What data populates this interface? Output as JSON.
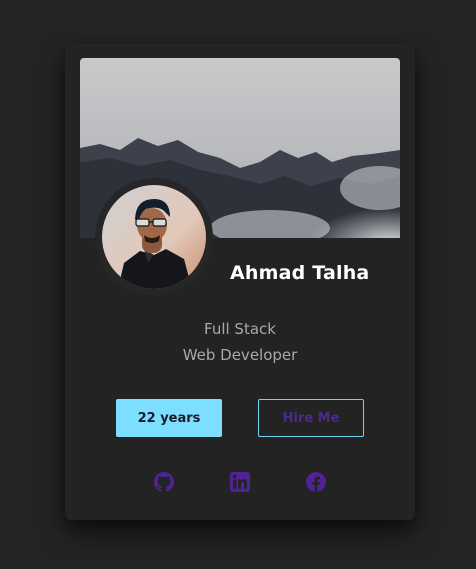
{
  "profile": {
    "name": "Ahmad Talha",
    "role_line1": "Full Stack",
    "role_line2": "Web Developer"
  },
  "buttons": {
    "age_label": "22 years",
    "hire_label": "Hire Me"
  },
  "socials": [
    {
      "icon": "github-icon"
    },
    {
      "icon": "linkedin-icon"
    },
    {
      "icon": "facebook-icon"
    }
  ],
  "colors": {
    "accent": "#7ddfff",
    "social_icon": "#4f2394",
    "card_bg": "#232323",
    "page_bg": "#242424"
  }
}
